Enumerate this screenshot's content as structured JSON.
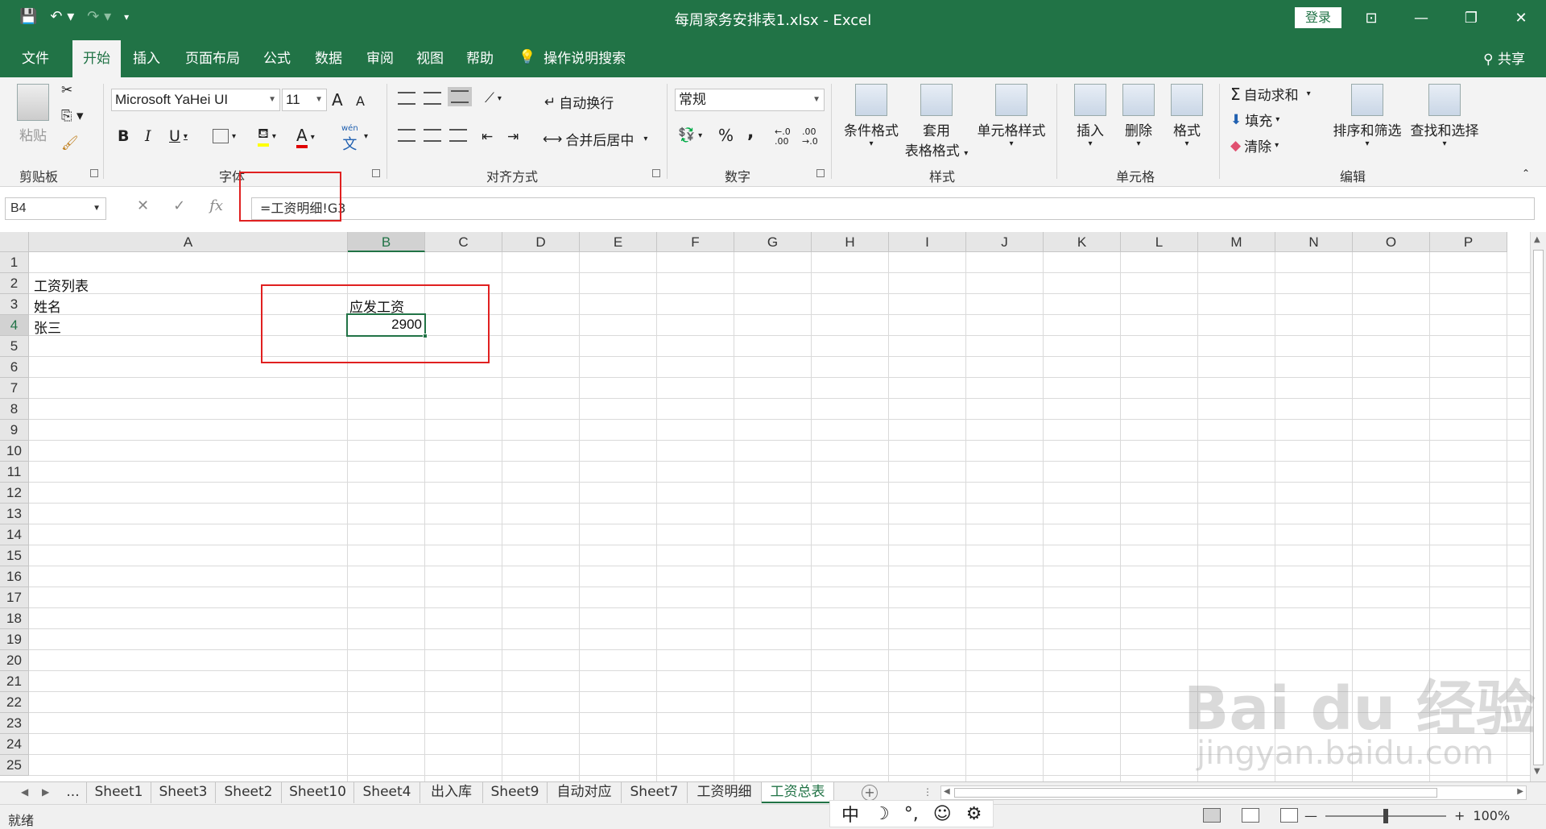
{
  "window": {
    "title": "每周家务安排表1.xlsx  -  Excel",
    "login_label": "登录",
    "qat": {
      "save_icon": "save-icon",
      "undo_icon": "undo-icon",
      "redo_icon": "redo-icon"
    }
  },
  "tabs": [
    "文件",
    "开始",
    "插入",
    "页面布局",
    "公式",
    "数据",
    "审阅",
    "视图",
    "帮助"
  ],
  "tell_me": "操作说明搜索",
  "share_label": "共享",
  "ribbon": {
    "clipboard": {
      "paste": "粘贴",
      "label": "剪贴板"
    },
    "font": {
      "name": "Microsoft YaHei UI",
      "size": "11",
      "label": "字体",
      "bold": "B",
      "italic": "I",
      "underline": "U",
      "grow": "A",
      "shrink": "A",
      "phonetic_top": "wén",
      "phonetic": "文"
    },
    "alignment": {
      "wrap": "自动换行",
      "merge": "合并后居中",
      "label": "对齐方式"
    },
    "number": {
      "format": "常规",
      "percent": "%",
      "comma": ",",
      "inc": "←.0 .00",
      "dec": ".00 →.0",
      "label": "数字"
    },
    "styles": {
      "conditional": "条件格式",
      "table_top": "套用",
      "table_bottom": "表格格式",
      "cell_styles": "单元格样式",
      "label": "样式"
    },
    "cells": {
      "insert": "插入",
      "delete": "删除",
      "format": "格式",
      "label": "单元格"
    },
    "editing": {
      "autosum": "自动求和",
      "fill": "填充",
      "clear": "清除",
      "sort": "排序和筛选",
      "find": "查找和选择",
      "label": "编辑"
    }
  },
  "formula_bar": {
    "name_box": "B4",
    "formula": "=工资明细!G3",
    "fx": "fx"
  },
  "grid": {
    "columns": [
      "A",
      "B",
      "C",
      "D",
      "E",
      "F",
      "G",
      "H",
      "I",
      "J",
      "K",
      "L",
      "M",
      "N",
      "O",
      "P"
    ],
    "rows": [
      "1",
      "2",
      "3",
      "4",
      "5",
      "6",
      "7",
      "8",
      "9",
      "10",
      "11",
      "12",
      "13",
      "14",
      "15",
      "16",
      "17",
      "18",
      "19",
      "20",
      "21",
      "22",
      "23",
      "24",
      "25"
    ],
    "cells": {
      "A2": "工资列表",
      "A3": "姓名",
      "B3": "应发工资",
      "A4": "张三",
      "B4": "2900"
    },
    "selected_cell": "B4"
  },
  "sheet_tabs": [
    "...",
    "Sheet1",
    "Sheet3",
    "Sheet2",
    "Sheet10",
    "Sheet4",
    "出入库",
    "Sheet9",
    "自动对应",
    "Sheet7",
    "工资明细",
    "工资总表"
  ],
  "active_sheet": "工资总表",
  "status": {
    "text": "就绪",
    "ime": [
      "中",
      "☽",
      "°,",
      "☺",
      "⚙"
    ],
    "zoom": "100%"
  },
  "watermark": {
    "logo": "Bai du 经验",
    "url": "jingyan.baidu.com"
  }
}
